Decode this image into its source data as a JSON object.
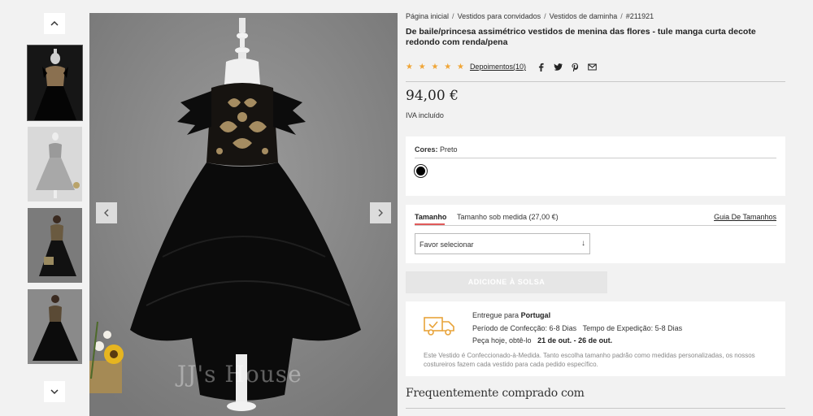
{
  "thumbnails": {
    "up_icon": "chevron-up",
    "down_icon": "chevron-down",
    "items": [
      "thumb-1",
      "thumb-2",
      "thumb-3",
      "thumb-4"
    ]
  },
  "gallery": {
    "watermark": "JJ's House",
    "prev_icon": "chevron-left",
    "next_icon": "chevron-right"
  },
  "breadcrumb": [
    "Página inicial",
    "Vestidos para convidados",
    "Vestidos de daminha",
    "#211921"
  ],
  "product": {
    "title": "De baile/princesa assimétrico vestidos de menina das flores - tule manga curta decote redondo com renda/pena",
    "stars": "★ ★ ★ ★ ★",
    "rating": 5,
    "reviews_label": "Depoimentos(10)",
    "price": "94,00 €",
    "vat": "IVA incluído"
  },
  "colors": {
    "label": "Cores:",
    "selected": "Preto",
    "swatch_color": "#000000"
  },
  "size": {
    "tab_size": "Tamanho",
    "tab_custom": "Tamanho sob medida (27,00 €)",
    "guide": "Guia De Tamanhos",
    "select_placeholder": "Favor selecionar",
    "select_arrow": "↓"
  },
  "add_to_bag": "ADICIONE À SOLSA",
  "shipping": {
    "delivered_prefix": "Entregue para",
    "country": "Portugal",
    "making_period": "Período de Confecção: 6-8 Dias",
    "shipping_time": "Tempo de Expedição: 5-8 Dias",
    "order_prefix": "Peça hoje, obtê-lo",
    "dates": "21 de out. - 26 de out.",
    "note": "Este Vestido é Confeccionado-à-Medida. Tanto escolha tamanho padrão como medidas personalizadas, os nossos costureiros fazem cada vestido para cada pedido específico."
  },
  "frequently_bought": "Frequentemente comprado com",
  "colors_theme": {
    "star": "#f0a536",
    "accent": "#e05a5a",
    "truck": "#e8a33a"
  }
}
